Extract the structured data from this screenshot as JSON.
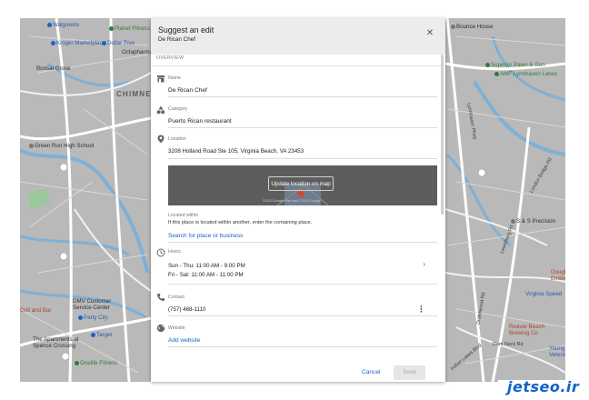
{
  "dialog": {
    "title": "Suggest an edit",
    "subtitle": "De Rican Chef",
    "close_icon": "close-icon",
    "overview_label": "OVERVIEW",
    "fields": {
      "name": {
        "label": "Name",
        "value": "De Rican Chef",
        "icon": "storefront-icon"
      },
      "category": {
        "label": "Category",
        "value": "Puerto Rican restaurant",
        "icon": "category-icon"
      },
      "location": {
        "label": "Location",
        "value": "3208 Holland Road Ste 105, Virginia Beach, VA 23453",
        "icon": "location-pin-icon",
        "map_button": "Update location on map",
        "map_credit": "©2019 Google   Map data ©2019 Google",
        "located_within_label": "Located within",
        "located_within_hint": "If this place is located within another, enter the containing place.",
        "search_link": "Search for place or business"
      },
      "hours": {
        "label": "Hours",
        "line1": "Sun - Thu: 11:00 AM - 9:00 PM",
        "line2": "Fri - Sat: 11:00 AM - 11:00 PM",
        "icon": "clock-icon"
      },
      "contact": {
        "label": "Contact",
        "value": "(757) 468-1110",
        "icon": "phone-icon"
      },
      "website": {
        "label": "Website",
        "link": "Add website",
        "icon": "globe-icon"
      }
    },
    "actions": {
      "cancel": "Cancel",
      "send": "Send"
    }
  },
  "map": {
    "area_label": "CHIMNE",
    "places": {
      "walgreens": "Walgreens",
      "planet_fitness": "Planet Fitness",
      "kroger": "Kroger Marketplace",
      "dollar_tree": "Dollar Tree",
      "octapharma": "Octapharma",
      "bonsai_grove": "Bonsai Grove",
      "green_run": "Green Run High School",
      "dmv": "DMV Customer Service Center",
      "grill_and_bar": "Grill and Bar",
      "party_city": "Party City",
      "target": "Target",
      "apartments": "The Apartments at Spence Crossing",
      "onelife": "Onelife Fitness",
      "bounce_house": "Bounce House",
      "superior_pawn": "Superior Pawn & Gun",
      "amf": "AMF Lynnhaven Lanes",
      "ss_precision": "S & S Precision",
      "virginia_speed": "Virginia Speed",
      "doughe": "Dough Embers",
      "reaver": "Reaver Beach Brewing Co",
      "young": "Young Veterin"
    },
    "streets": {
      "lynnhaven": "Lynnhaven Pkwy",
      "lewisburg": "Lewisburg Rd",
      "london_bridge": "London Bridge Rd",
      "drakewood": "Drakewood Rd",
      "dam_neck": "Dam Neck Rd",
      "indian_lakes": "Indian Lakes Blvd"
    }
  },
  "watermark": "jetseo.ir",
  "colors": {
    "accent": "#1a62c8",
    "header_bg": "#ececec",
    "map_bg": "#b9b9b9"
  }
}
